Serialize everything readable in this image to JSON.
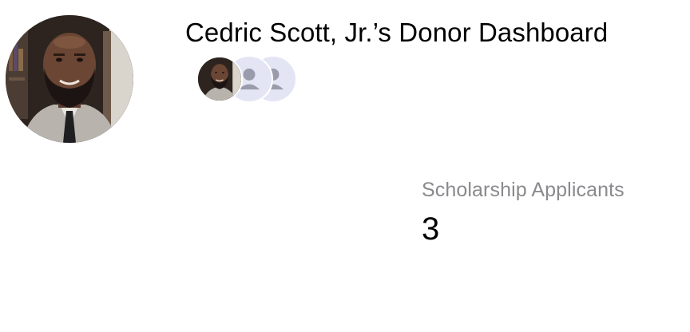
{
  "dashboard": {
    "title": "Cedric Scott, Jr.’s Donor Dashboard"
  },
  "supporters": {
    "avatars": [
      "photo",
      "placeholder",
      "placeholder"
    ]
  },
  "stats": {
    "label": "Scholarship Applicants",
    "value": "3"
  }
}
